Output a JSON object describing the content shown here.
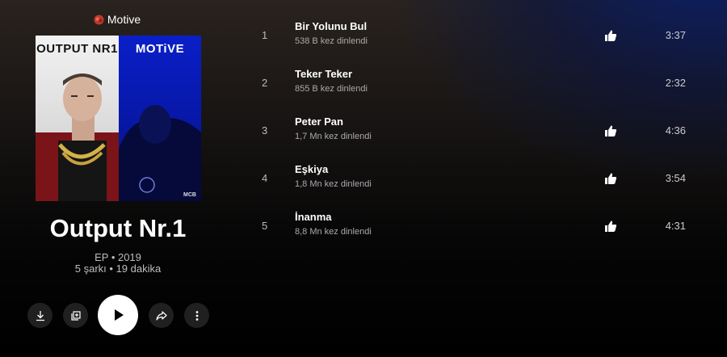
{
  "artist": {
    "name": "Motive",
    "icon": "artist-avatar-icon"
  },
  "album": {
    "cover_left_text": "OUTPUT NR1",
    "cover_right_text": "MOTiVE",
    "cover_logo_text": "MCB",
    "title": "Output Nr.1",
    "type_year": "EP • 2019",
    "summary": "5 şarkı • 19 dakika"
  },
  "controls": [
    {
      "name": "download-button",
      "icon": "download-icon"
    },
    {
      "name": "save-to-library-button",
      "icon": "library-add-icon"
    },
    {
      "name": "play-button",
      "icon": "play-icon"
    },
    {
      "name": "share-button",
      "icon": "share-icon"
    },
    {
      "name": "more-options-button",
      "icon": "more-vert-icon"
    }
  ],
  "tracks": [
    {
      "number": "1",
      "title": "Bir Yolunu Bul",
      "plays": "538 B kez dinlendi",
      "liked": true,
      "duration": "3:37"
    },
    {
      "number": "2",
      "title": "Teker Teker",
      "plays": "855 B kez dinlendi",
      "liked": false,
      "duration": "2:32"
    },
    {
      "number": "3",
      "title": "Peter Pan",
      "plays": "1,7 Mn kez dinlendi",
      "liked": true,
      "duration": "4:36"
    },
    {
      "number": "4",
      "title": "Eşkiya",
      "plays": "1,8 Mn kez dinlendi",
      "liked": true,
      "duration": "3:54"
    },
    {
      "number": "5",
      "title": "İnanma",
      "plays": "8,8 Mn kez dinlendi",
      "liked": true,
      "duration": "4:31"
    }
  ],
  "colors": {
    "cover_blue": "#0a1fc8",
    "like_icon": "#ffffff",
    "muted_text": "#bdbdbd"
  }
}
